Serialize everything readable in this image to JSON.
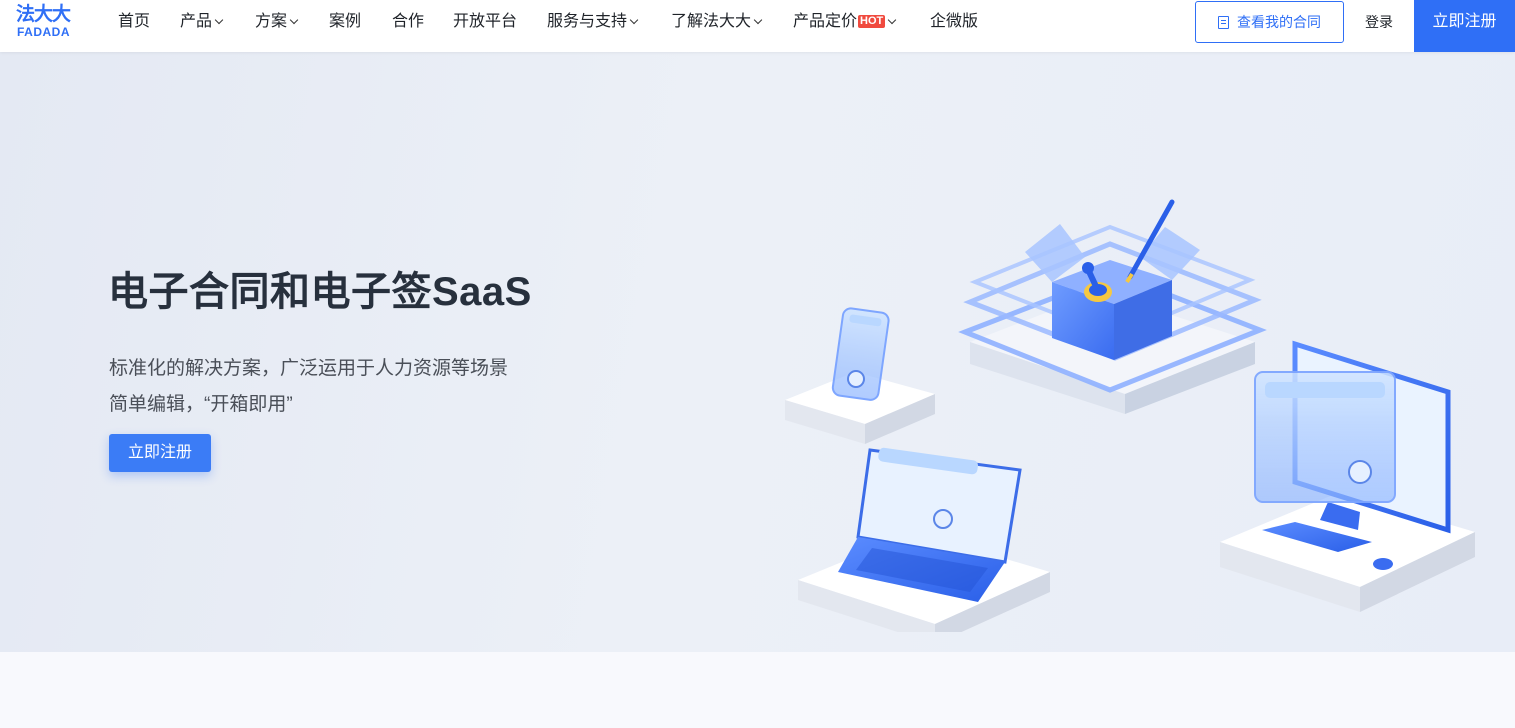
{
  "logo": {
    "cn": "法大大",
    "en": "FADADA"
  },
  "nav": {
    "items": [
      {
        "label": "首页",
        "dropdown": false,
        "hot": false
      },
      {
        "label": "产品",
        "dropdown": true,
        "hot": false
      },
      {
        "label": "方案",
        "dropdown": true,
        "hot": false
      },
      {
        "label": "案例",
        "dropdown": false,
        "hot": false
      },
      {
        "label": "合作",
        "dropdown": false,
        "hot": false
      },
      {
        "label": "开放平台",
        "dropdown": false,
        "hot": false
      },
      {
        "label": "服务与支持",
        "dropdown": true,
        "hot": false
      },
      {
        "label": "了解法大大",
        "dropdown": true,
        "hot": false
      },
      {
        "label": "产品定价",
        "dropdown": true,
        "hot": true,
        "badge": "HOT"
      },
      {
        "label": "企微版",
        "dropdown": false,
        "hot": false
      }
    ],
    "contract_button": "查看我的合同",
    "login": "登录",
    "register": "立即注册"
  },
  "hero": {
    "title": "电子合同和电子签SaaS",
    "subtitle_line1": "标准化的解决方案，广泛运用于人力资源等场景",
    "subtitle_line2": "简单编辑，“开箱即用”",
    "cta": "立即注册"
  },
  "colors": {
    "brand": "#2f6ff6",
    "hot": "#f04a3e",
    "hero_bg": "#e8edf5"
  }
}
